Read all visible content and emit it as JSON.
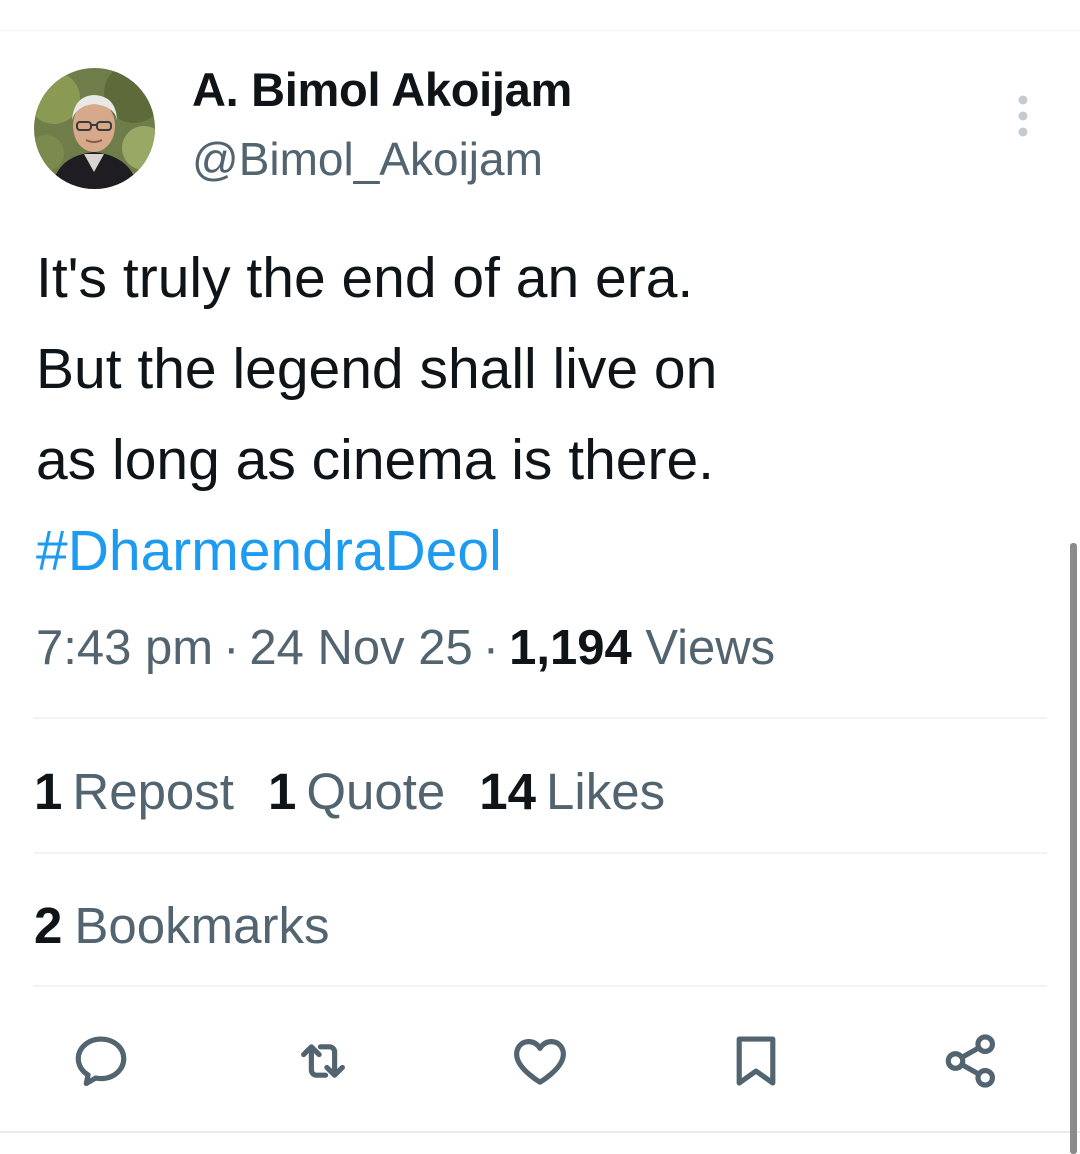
{
  "author": {
    "display_name": "A. Bimol Akoijam",
    "handle": "@Bimol_Akoijam"
  },
  "tweet": {
    "lines": [
      "It's truly the end of an era.",
      "But the legend shall live on",
      "as long as cinema is there."
    ],
    "hashtag": "#DharmendraDeol"
  },
  "meta": {
    "time": "7:43 pm",
    "separator": "·",
    "date": "24 Nov 25",
    "views_count": "1,194",
    "views_label": "Views"
  },
  "stats": {
    "reposts_count": "1",
    "reposts_label": "Repost",
    "quotes_count": "1",
    "quotes_label": "Quote",
    "likes_count": "14",
    "likes_label": "Likes",
    "bookmarks_count": "2",
    "bookmarks_label": "Bookmarks"
  },
  "actions": {
    "icons": [
      "reply-icon",
      "repost-icon",
      "like-icon",
      "bookmark-icon",
      "share-icon"
    ]
  },
  "colors": {
    "text": "#0f1419",
    "secondary": "#536471",
    "link": "#1d9bf0",
    "divider": "#eff3f4"
  }
}
